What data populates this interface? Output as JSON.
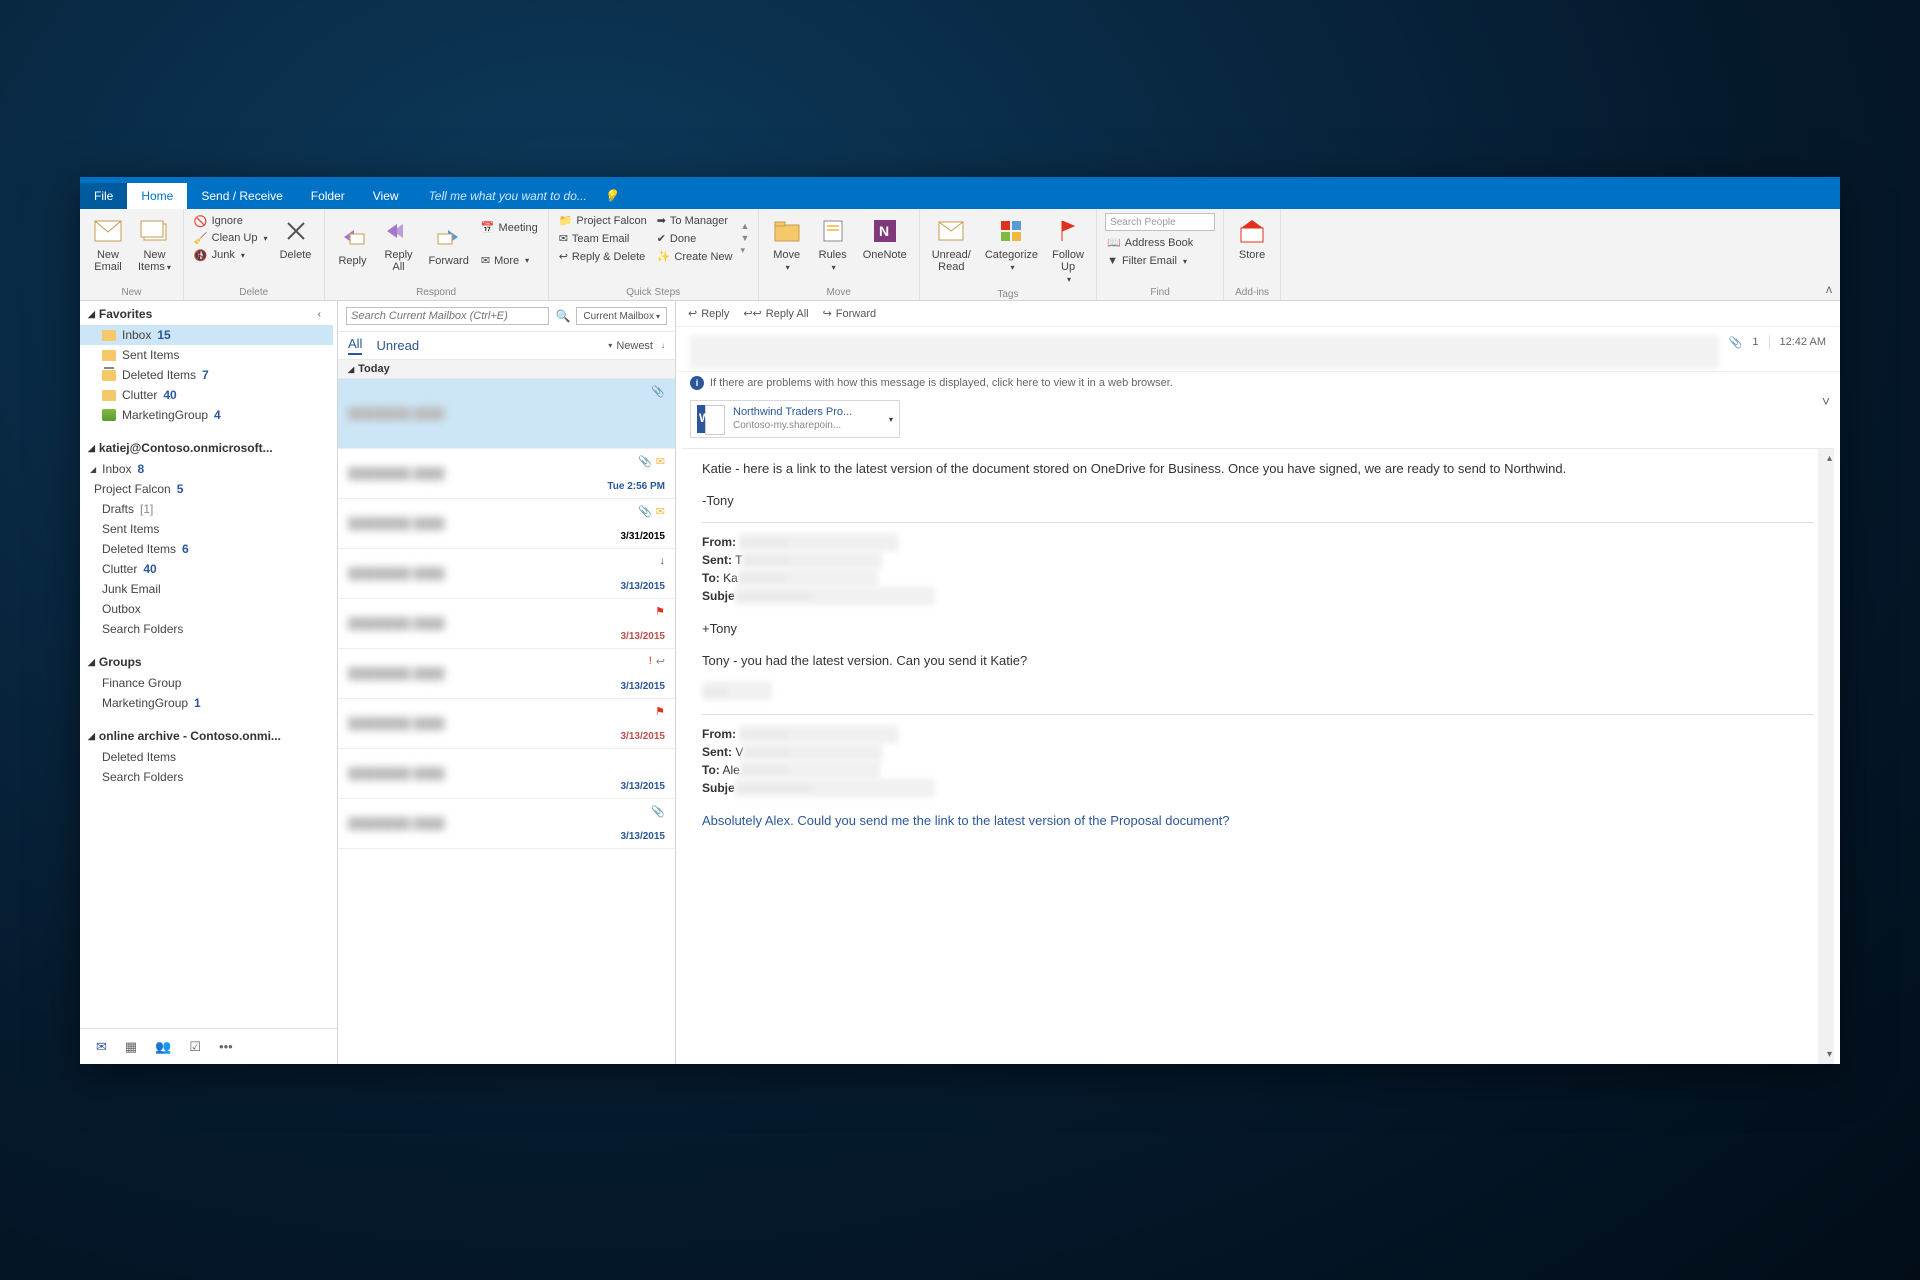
{
  "tabs": {
    "file": "File",
    "home": "Home",
    "sendreceive": "Send / Receive",
    "folder": "Folder",
    "view": "View",
    "tellme": "Tell me what you want to do..."
  },
  "ribbon": {
    "new": {
      "email": "New\nEmail",
      "items": "New\nItems",
      "label": "New"
    },
    "delete": {
      "ignore": "Ignore",
      "cleanup": "Clean Up",
      "junk": "Junk",
      "delete": "Delete",
      "label": "Delete"
    },
    "respond": {
      "reply": "Reply",
      "replyall": "Reply\nAll",
      "forward": "Forward",
      "meeting": "Meeting",
      "more": "More",
      "label": "Respond"
    },
    "quicksteps": {
      "pf": "Project Falcon",
      "te": "Team Email",
      "rd": "Reply & Delete",
      "tm": "To Manager",
      "done": "Done",
      "cn": "Create New",
      "label": "Quick Steps"
    },
    "move": {
      "move": "Move",
      "rules": "Rules",
      "onenote": "OneNote",
      "label": "Move"
    },
    "tags": {
      "unread": "Unread/\nRead",
      "categorize": "Categorize",
      "followup": "Follow\nUp",
      "label": "Tags"
    },
    "find": {
      "search": "Search People",
      "addressbook": "Address Book",
      "filter": "Filter Email",
      "label": "Find"
    },
    "addins": {
      "store": "Store",
      "label": "Add-ins"
    }
  },
  "nav": {
    "favorites": "Favorites",
    "fav_items": [
      {
        "label": "Inbox",
        "count": "15",
        "selected": true
      },
      {
        "label": "Sent Items"
      },
      {
        "label": "Deleted Items",
        "count": "7"
      },
      {
        "label": "Clutter",
        "count": "40"
      },
      {
        "label": "MarketingGroup",
        "count": "4",
        "group": true
      }
    ],
    "account": "katiej@Contoso.onmicrosoft...",
    "acct_items": [
      {
        "label": "Inbox",
        "count": "8",
        "expandable": true
      },
      {
        "label": "Project Falcon",
        "count": "5",
        "indent": true
      },
      {
        "label": "Drafts",
        "count": "[1]",
        "gray": true
      },
      {
        "label": "Sent Items"
      },
      {
        "label": "Deleted Items",
        "count": "6"
      },
      {
        "label": "Clutter",
        "count": "40"
      },
      {
        "label": "Junk Email"
      },
      {
        "label": "Outbox"
      },
      {
        "label": "Search Folders"
      }
    ],
    "groups": "Groups",
    "grp_items": [
      {
        "label": "Finance Group"
      },
      {
        "label": "MarketingGroup",
        "count": "1"
      }
    ],
    "archive": "online archive - Contoso.onmi...",
    "arc_items": [
      {
        "label": "Deleted Items"
      },
      {
        "label": "Search Folders"
      }
    ]
  },
  "list": {
    "search_placeholder": "Search Current Mailbox (Ctrl+E)",
    "scope": "Current Mailbox",
    "all": "All",
    "unread": "Unread",
    "sort": "Newest",
    "today": "Today",
    "items": [
      {
        "date": "",
        "icons": "clip",
        "selected": true
      },
      {
        "date": "Tue 2:56 PM",
        "icons": "clip env",
        "blue": true
      },
      {
        "date": "3/31/2015",
        "icons": "clip env"
      },
      {
        "date": "3/13/2015",
        "icons": "down",
        "blue": true
      },
      {
        "date": "3/13/2015",
        "icons": "flag",
        "red": true
      },
      {
        "date": "3/13/2015",
        "icons": "excl reply",
        "blue": true
      },
      {
        "date": "3/13/2015",
        "icons": "flag",
        "red": true
      },
      {
        "date": "3/13/2015",
        "icons": "",
        "blue": true
      },
      {
        "date": "3/13/2015",
        "icons": "clip",
        "blue": true
      }
    ]
  },
  "read": {
    "reply": "Reply",
    "replyall": "Reply All",
    "forward": "Forward",
    "attach_count": "1",
    "time": "12:42 AM",
    "infobar": "If there are problems with how this message is displayed, click here to view it in a web browser.",
    "attach_name": "Northwind Traders Pro...",
    "attach_loc": "Contoso-my.sharepoin...",
    "body1": "Katie - here is a link to the latest version of the document stored on OneDrive for Business. Once you have signed, we are ready to send to Northwind.",
    "sig1": "-Tony",
    "from": "From:",
    "sent": "Sent:",
    "sent_v": "T",
    "to": "To:",
    "to_v": "Ka",
    "subj": "Subje",
    "body2a": "+Tony",
    "body2b": "Tony - you had the latest version. Can you send it Katie?",
    "sent_v2": "V",
    "to_v2": "Ale",
    "body3": "Absolutely Alex. Could you send me the link to the latest version of the Proposal document?"
  }
}
